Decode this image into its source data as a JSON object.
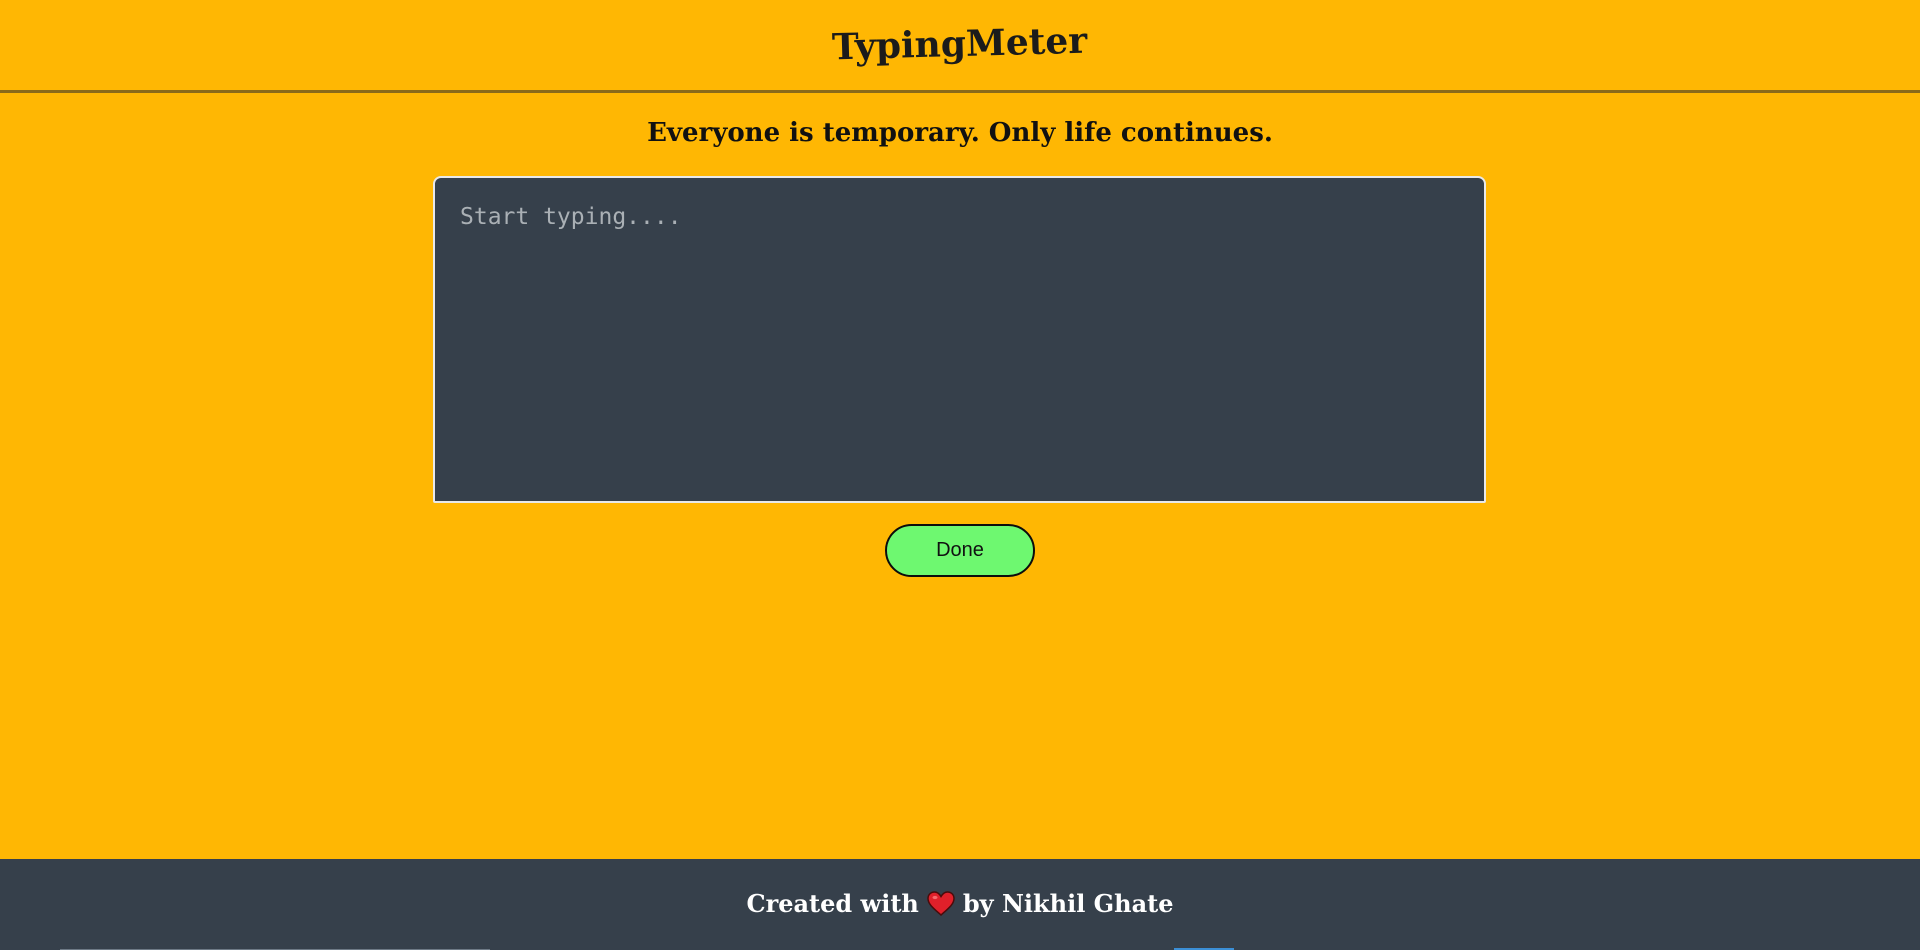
{
  "header": {
    "logo_text": "TypingMeter"
  },
  "main": {
    "quote": "Everyone is temporary. Only life continues.",
    "typing_area": {
      "placeholder": "Start typing....",
      "value": ""
    },
    "done_label": "Done"
  },
  "footer": {
    "prefix": "Created with",
    "icon": "heart-icon",
    "suffix": "by Nikhil Ghate"
  },
  "colors": {
    "background": "#ffb703",
    "panel": "#36404b",
    "button": "#6ef870",
    "heart": "#e0202a"
  }
}
